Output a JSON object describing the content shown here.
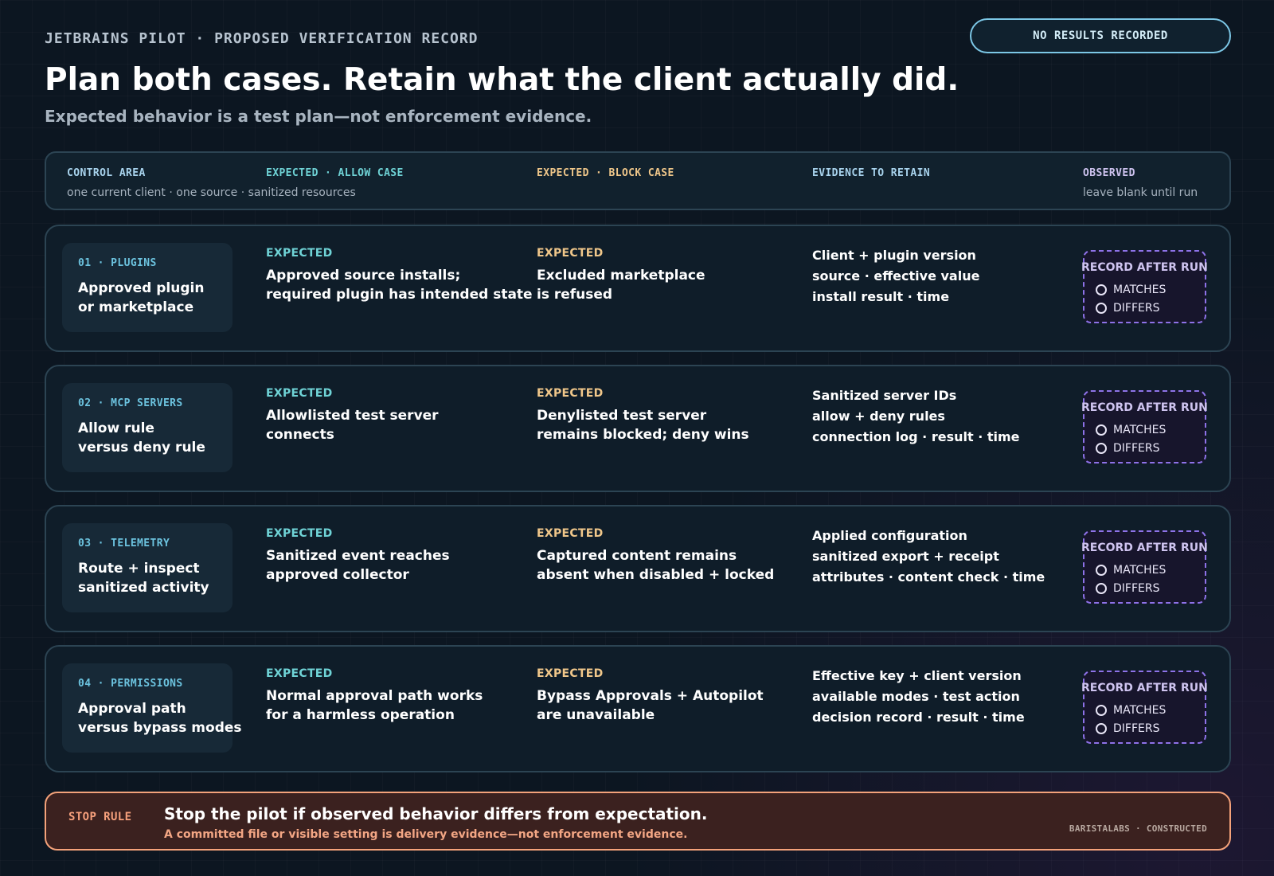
{
  "header": {
    "eyebrow": "JETBRAINS PILOT · PROPOSED VERIFICATION RECORD",
    "badge": "NO RESULTS RECORDED",
    "title": "Plan both cases. Retain what the client actually did.",
    "subtitle": "Expected behavior is a test plan—not enforcement evidence."
  },
  "columns": {
    "control_area": "CONTROL AREA",
    "control_area_sub": "one current client · one source · sanitized resources",
    "allow": "EXPECTED · ALLOW CASE",
    "block": "EXPECTED · BLOCK CASE",
    "evidence": "EVIDENCE TO RETAIN",
    "observed": "OBSERVED",
    "observed_sub": "leave blank until run"
  },
  "labels": {
    "expected": "EXPECTED",
    "record_after_run": "RECORD AFTER RUN",
    "matches": "MATCHES",
    "differs": "DIFFERS"
  },
  "rows": [
    {
      "tag": "01 · PLUGINS",
      "title": [
        "Approved plugin",
        "or marketplace"
      ],
      "allow": [
        "Approved source installs;",
        "required plugin has intended state"
      ],
      "block": [
        "Excluded marketplace",
        "is refused"
      ],
      "evidence": [
        "Client + plugin version",
        "source · effective value",
        "install result · time"
      ]
    },
    {
      "tag": "02 · MCP SERVERS",
      "title": [
        "Allow rule",
        "versus deny rule"
      ],
      "allow": [
        "Allowlisted test server",
        "connects"
      ],
      "block": [
        "Denylisted test server",
        "remains blocked; deny wins"
      ],
      "evidence": [
        "Sanitized server IDs",
        "allow + deny rules",
        "connection log · result · time"
      ]
    },
    {
      "tag": "03 · TELEMETRY",
      "title": [
        "Route + inspect",
        "sanitized activity"
      ],
      "allow": [
        "Sanitized event reaches",
        "approved collector"
      ],
      "block": [
        "Captured content remains",
        "absent when disabled + locked"
      ],
      "evidence": [
        "Applied configuration",
        "sanitized export + receipt",
        "attributes · content check · time"
      ]
    },
    {
      "tag": "04 · PERMISSIONS",
      "title": [
        "Approval path",
        "versus bypass modes"
      ],
      "allow": [
        "Normal approval path works",
        "for a harmless operation"
      ],
      "block": [
        "Bypass Approvals + Autopilot",
        "are unavailable"
      ],
      "evidence": [
        "Effective key + client version",
        "available modes · test action",
        "decision record · result · time"
      ]
    }
  ],
  "stop": {
    "tag": "STOP RULE",
    "title": "Stop the pilot if observed behavior differs from expectation.",
    "sub": "A committed file or visible setting is delivery evidence—not enforcement evidence.",
    "credit": "BARISTALABS · CONSTRUCTED"
  },
  "colors": {
    "allow_accent": "#6fd3d6",
    "block_accent": "#f0c78a",
    "observed_accent": "#8e72e8",
    "stop_accent": "#f4a27a"
  }
}
